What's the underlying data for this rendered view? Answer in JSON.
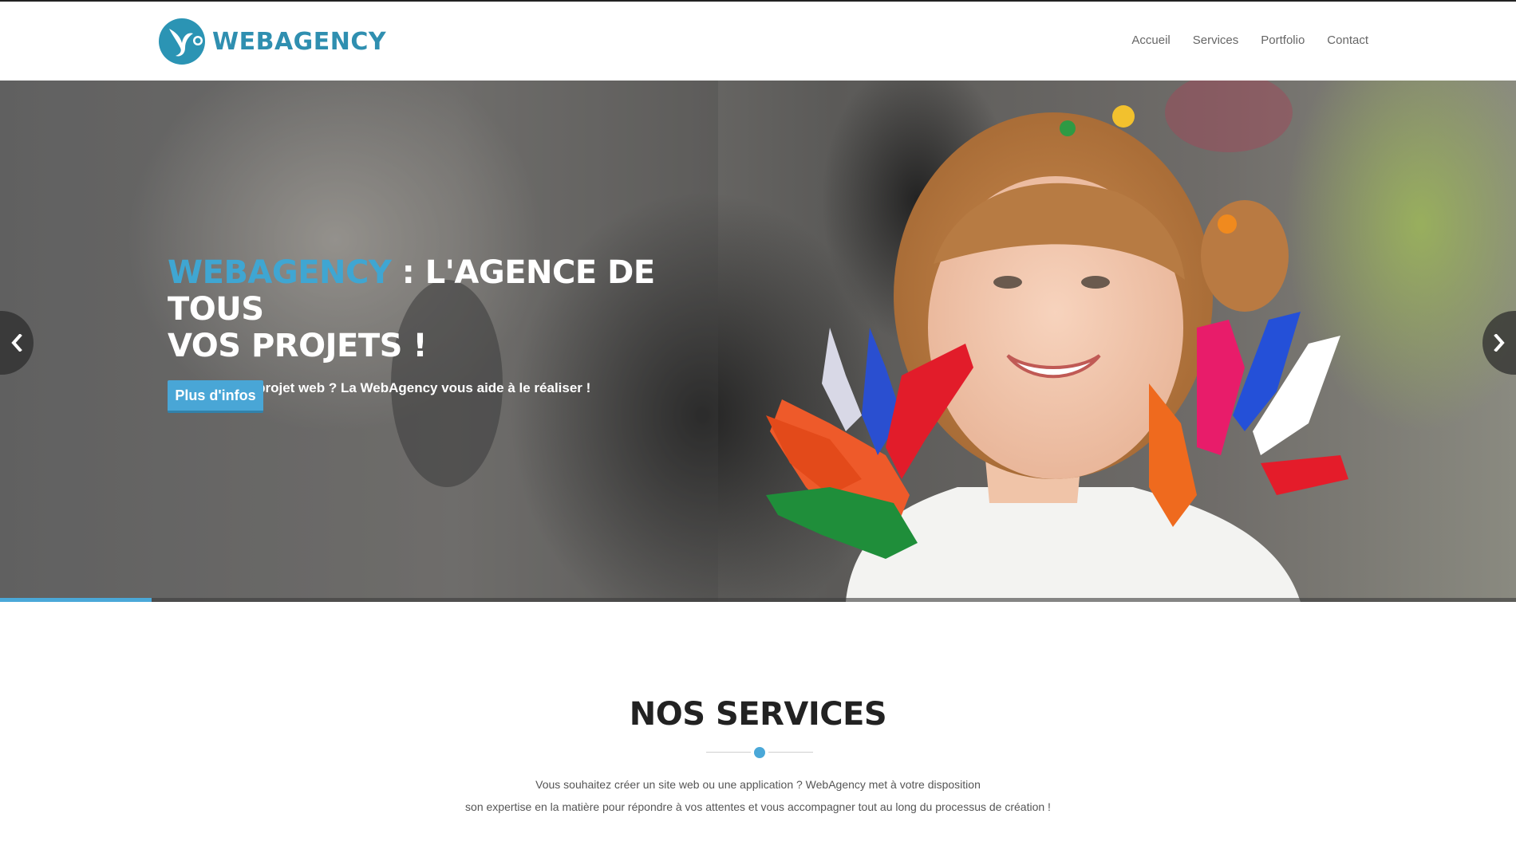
{
  "brand": {
    "logo_text": "WEBAGENCY",
    "logo_icon": "webagency-logo-icon",
    "accent_color": "#3fa6d2"
  },
  "nav": {
    "items": [
      {
        "label": "Accueil"
      },
      {
        "label": "Services"
      },
      {
        "label": "Portfolio"
      },
      {
        "label": "Contact"
      }
    ]
  },
  "hero": {
    "title_brand": "WEBAGENCY",
    "title_rest_line1": " : L'AGENCE DE TOUS",
    "title_line2": "VOS PROJETS !",
    "subtitle": "Vous avez un projet web ? La WebAgency vous aide à le réaliser !",
    "button_label": "Plus d'infos",
    "prev_icon": "chevron-left-icon",
    "next_icon": "chevron-right-icon",
    "slide_progress": 0.1
  },
  "services": {
    "title": "NOS SERVICES",
    "description_line1": "Vous souhaitez créer un site web ou une application ? WebAgency met à votre disposition",
    "description_line2": "son expertise en la matière pour répondre à vos attentes et vous accompagner tout au long du processus de création !"
  }
}
